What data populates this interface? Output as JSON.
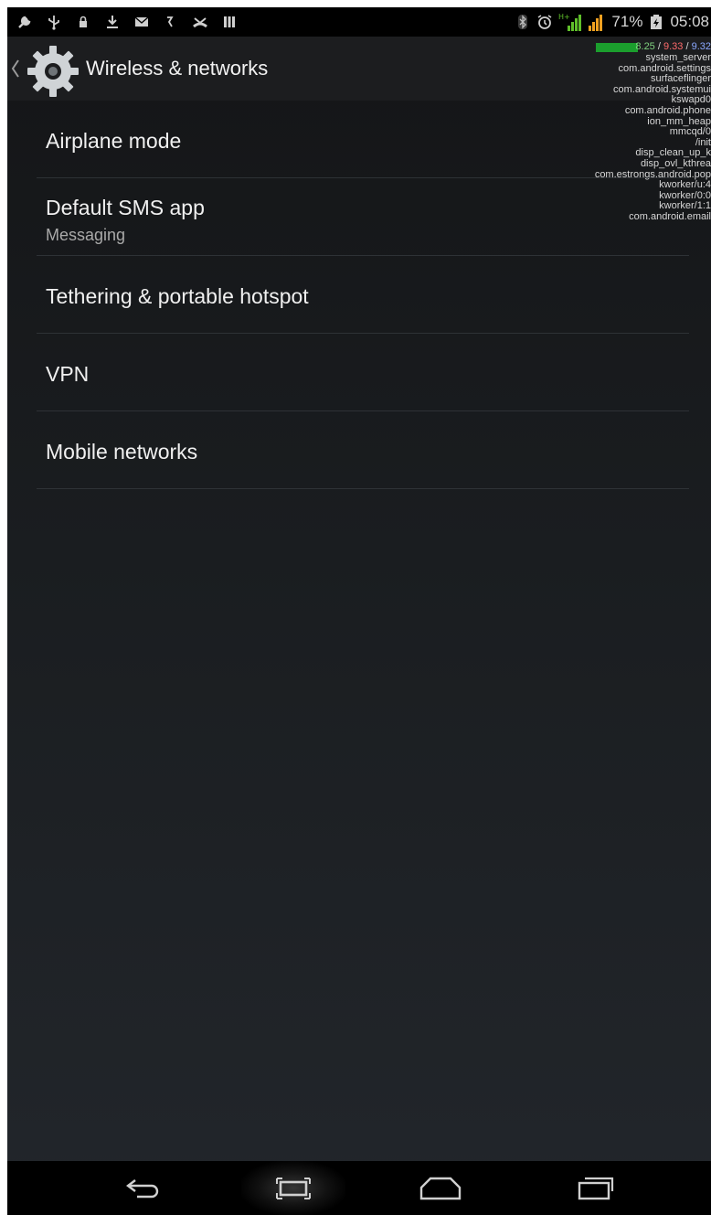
{
  "status_bar": {
    "battery_percent": "71%",
    "time": "05:08",
    "network_type": "H+"
  },
  "action_bar": {
    "title": "Wireless & networks"
  },
  "cpu_overlay": {
    "load": [
      "8.25",
      "9.33",
      "9.32"
    ],
    "load_separator": " / ",
    "processes": [
      "system_server",
      "com.android.settings",
      "surfaceflinger",
      "com.android.systemui",
      "kswapd0",
      "com.android.phone",
      "ion_mm_heap",
      "mmcqd/0",
      "/init",
      "disp_clean_up_k",
      "disp_ovl_kthrea",
      "com.estrongs.android.pop",
      "kworker/u:4",
      "kworker/0:0",
      "kworker/1:1",
      "com.android.email"
    ]
  },
  "settings": {
    "items": [
      {
        "title": "Airplane mode"
      },
      {
        "title": "Default SMS app",
        "subtitle": "Messaging"
      },
      {
        "title": "Tethering & portable hotspot"
      },
      {
        "title": "VPN"
      },
      {
        "title": "Mobile networks"
      }
    ]
  },
  "colors": {
    "background": "#1a1d20",
    "action_bar": "#1c1d1f",
    "divider": "#2e3236",
    "signal_green": "#5fbf2a",
    "signal_orange": "#f0a020"
  }
}
